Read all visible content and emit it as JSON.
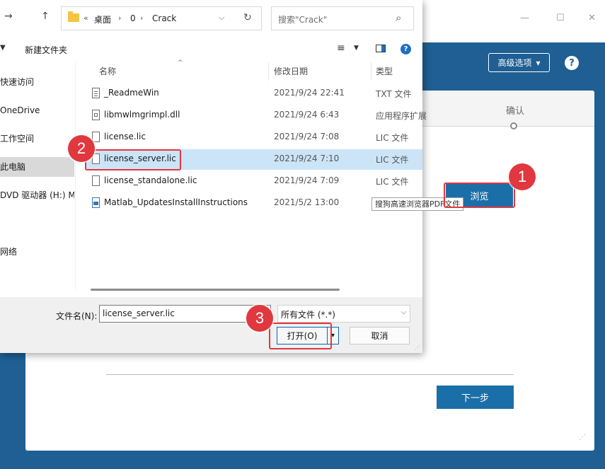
{
  "background_window": {
    "minimize_glyph": "—",
    "maximize_glyph": "☐",
    "close_glyph": "✕",
    "advanced_options_label": "高级选项",
    "advanced_caret": "▾",
    "help_glyph": "?",
    "step_label": "确认",
    "browse_label": "浏览",
    "next_label": "下一步",
    "accent_color": "#1f5f93",
    "button_color": "#1b6fa8"
  },
  "dialog": {
    "nav": {
      "back": "←",
      "forward": "→",
      "up": "↑"
    },
    "address": {
      "crumbs": [
        "桌面",
        "0",
        "Crack"
      ],
      "prefix": "«",
      "separator": "›",
      "dropdown_glyph": "⌵",
      "refresh_glyph": "↻"
    },
    "search": {
      "placeholder": "搜索\"Crack\"",
      "icon": "⌕"
    },
    "toolbar": {
      "organize_caret": "▼",
      "new_folder_label": "新建文件夹",
      "view_glyph": "≡",
      "view_caret": "▼",
      "help_glyph": "?"
    },
    "left_nav": [
      {
        "label": "快速访问",
        "selected": false
      },
      {
        "label": "OneDrive",
        "selected": false
      },
      {
        "label": "工作空间",
        "selected": false
      },
      {
        "label": "此电脑",
        "selected": true
      },
      {
        "label": "DVD 驱动器 (H:) M...",
        "selected": false
      },
      {
        "label": "网络",
        "selected": false
      }
    ],
    "columns": {
      "name": "名称",
      "date": "修改日期",
      "type": "类型",
      "sort_glyph": "^"
    },
    "files": [
      {
        "name": "_ReadmeWin",
        "date": "2021/9/24 22:41",
        "type": "TXT 文件",
        "icon": "text-file-icon",
        "selected": false
      },
      {
        "name": "libmwlmgrimpl.dll",
        "date": "2021/9/24 6:43",
        "type": "应用程序扩展",
        "icon": "dll-file-icon",
        "selected": false
      },
      {
        "name": "license.lic",
        "date": "2021/9/24 7:08",
        "type": "LIC 文件",
        "icon": "file-icon",
        "selected": false
      },
      {
        "name": "license_server.lic",
        "date": "2021/9/24 7:10",
        "type": "LIC 文件",
        "icon": "file-icon",
        "selected": true
      },
      {
        "name": "license_standalone.lic",
        "date": "2021/9/24 7:09",
        "type": "LIC 文件",
        "icon": "file-icon",
        "selected": false
      },
      {
        "name": "Matlab_UpdatesInstallInstructions",
        "date": "2021/5/2 13:00",
        "type": "",
        "icon": "pdf-file-icon",
        "selected": false
      }
    ],
    "tooltip": "搜狗高速浏览器PDF文件",
    "filename_label": "文件名(N):",
    "filename_value": "license_server.lic",
    "filter_value": "所有文件 (*.*)",
    "open_label": "打开(O)",
    "open_split_glyph": "▾",
    "cancel_label": "取消",
    "selection_color": "#cce4f7"
  },
  "annotations": {
    "badges": [
      "1",
      "2",
      "3"
    ],
    "color": "#e0383e"
  }
}
